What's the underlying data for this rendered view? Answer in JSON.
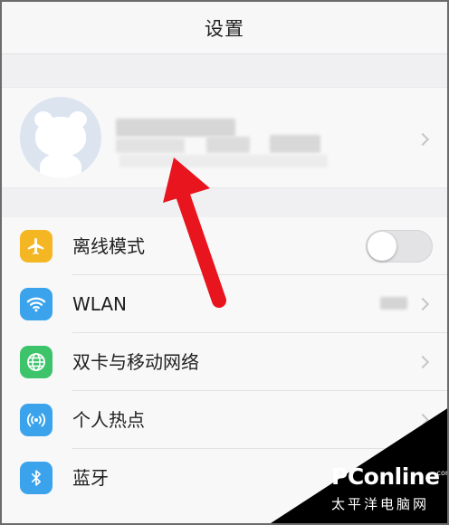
{
  "nav": {
    "title": "设置"
  },
  "account": {
    "avatar": "default-cartoon-avatar"
  },
  "settings": [
    {
      "label": "离线模式",
      "icon": "airplane-icon",
      "icon_color": "#f5b623",
      "control": "toggle",
      "toggle_on": false
    },
    {
      "label": "WLAN",
      "icon": "wifi-icon",
      "icon_color": "#3aa3ec",
      "control": "value"
    },
    {
      "label": "双卡与移动网络",
      "icon": "globe-icon",
      "icon_color": "#3dc46b",
      "control": "chevron"
    },
    {
      "label": "个人热点",
      "icon": "hotspot-icon",
      "icon_color": "#3aa3ec",
      "control": "chevron"
    },
    {
      "label": "蓝牙",
      "icon": "bluetooth-icon",
      "icon_color": "#3aa3ec",
      "control": "chevron"
    }
  ],
  "annotation": {
    "arrow_color": "#e8141e",
    "arrow_icon": "red-arrow-pointing-up"
  },
  "watermark": {
    "brand": "PConline",
    "brand_cn": "太平洋电脑网",
    "domain_suffix": ".com.cn"
  }
}
